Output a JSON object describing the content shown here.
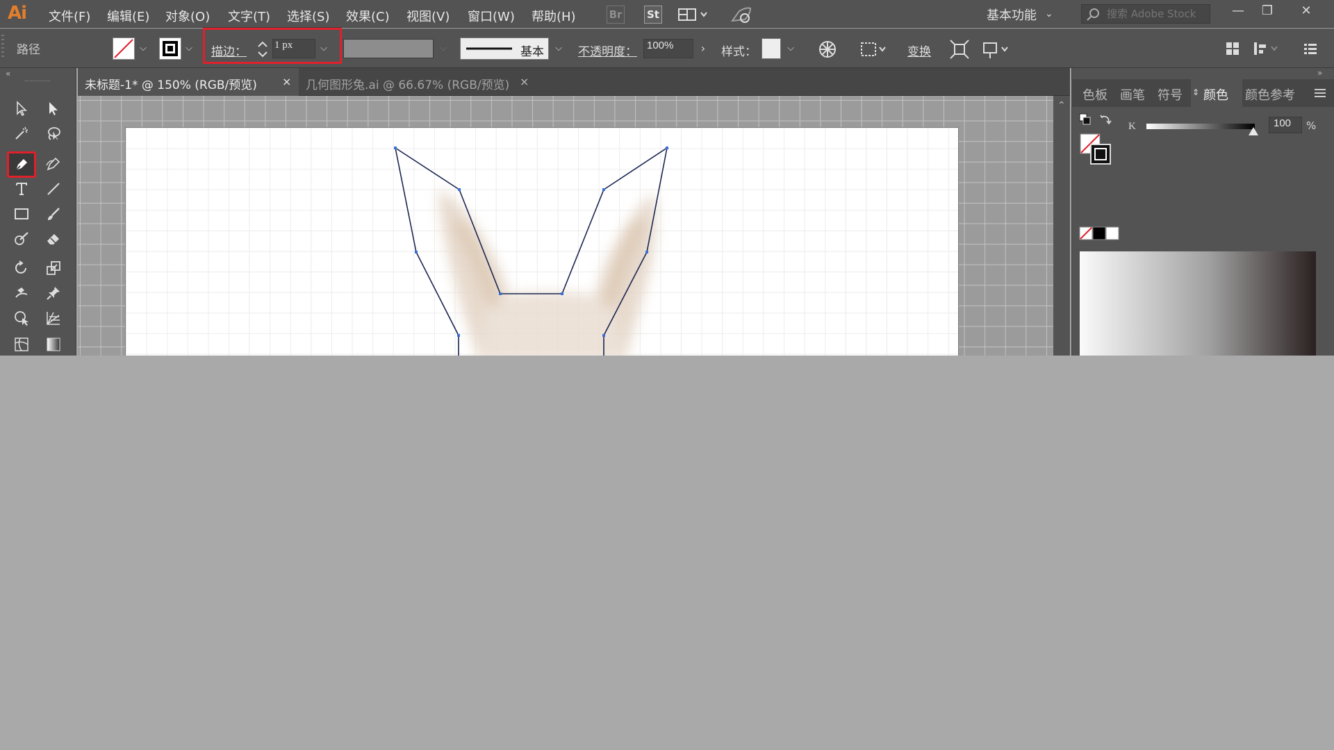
{
  "app": {
    "logo": "Ai",
    "menu": [
      "文件(F)",
      "编辑(E)",
      "对象(O)",
      "文字(T)",
      "选择(S)",
      "效果(C)",
      "视图(V)",
      "窗口(W)",
      "帮助(H)"
    ],
    "bridge_badge": "Br",
    "stock_badge": "St",
    "workspace": "基本功能",
    "search_placeholder": "搜索 Adobe Stock",
    "window_buttons": {
      "minimize": "—",
      "restore": "❐",
      "close": "✕"
    }
  },
  "control_bar": {
    "path_label": "路径",
    "stroke_label": "描边：",
    "stroke_value": "1 px",
    "stroke_profile": "基本",
    "opacity_label": "不透明度：",
    "opacity_value": "100%",
    "style_label": "样式：",
    "transform_label": "变换"
  },
  "document_tabs": [
    {
      "label": "未标题-1* @ 150% (RGB/预览)",
      "close": "×",
      "active": true
    },
    {
      "label": "几何图形兔.ai @ 66.67% (RGB/预览)",
      "close": "×",
      "active": false
    }
  ],
  "right_panel": {
    "tabs": [
      "色板",
      "画笔",
      "符号",
      "颜色",
      "颜色参考"
    ],
    "active_tab": "颜色",
    "k_label": "K",
    "k_value": "100",
    "k_unit": "%"
  },
  "colors": {
    "selection_highlight": "#e0202b",
    "path_stroke": "#1b2550",
    "anchor": "#3b6fd6",
    "ai_logo": "#e37e2b"
  },
  "active_tool": "pen-tool"
}
